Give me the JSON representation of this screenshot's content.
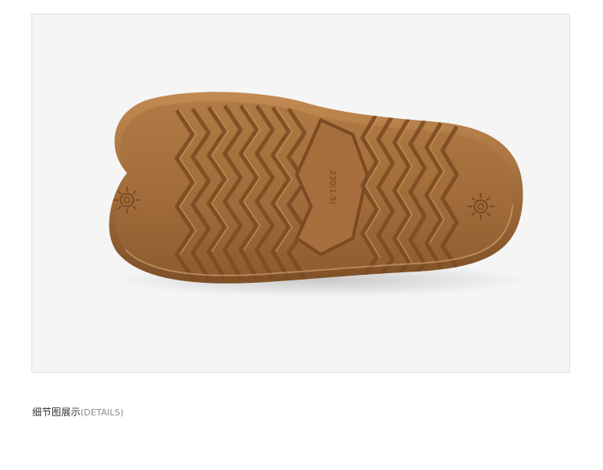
{
  "photo": {
    "subject": "sole-of-slide-sandal",
    "sole_color": "#a8723f",
    "sole_edge_color": "#8c5a2c",
    "background_color": "#f5f5f5",
    "sole_size_mark": "230(1.5)"
  },
  "caption": {
    "title": "细节图展示",
    "subtitle": "(DETAILS)"
  }
}
